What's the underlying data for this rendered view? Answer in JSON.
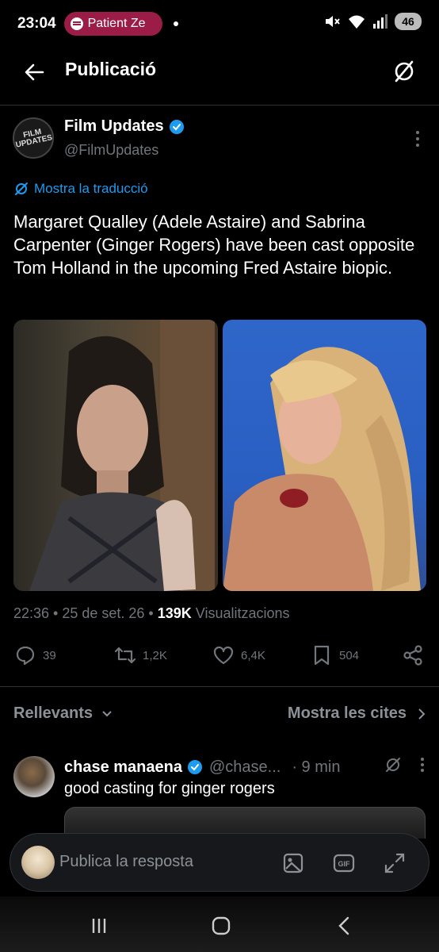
{
  "status_bar": {
    "time": "23:04",
    "spotify_label": "Patient Ze",
    "battery": "46"
  },
  "header": {
    "title": "Publicació"
  },
  "post": {
    "author_name": "Film Updates",
    "author_handle": "@FilmUpdates",
    "avatar_text": "FILM UPDATES",
    "translate_label": "Mostra la traducció",
    "text": "Margaret Qualley (Adele Astaire) and Sabrina Carpenter (Ginger Rogers) have been cast opposite Tom Holland in the upcoming Fred Astaire biopic.",
    "meta_time": "22:36 • 25 de set. 26 • ",
    "views_count": "139K",
    "views_label": " Visualitzacions",
    "replies": "39",
    "reposts": "1,2K",
    "likes": "6,4K",
    "bookmarks": "504"
  },
  "sort": {
    "left_label": "Rellevants",
    "right_label": "Mostra les cites"
  },
  "reply": {
    "name": "chase manaena",
    "handle": "@chase...",
    "time": "· 9 min",
    "text": "good casting for ginger rogers"
  },
  "compose": {
    "placeholder": "Publica la resposta"
  },
  "colors": {
    "accent": "#1d9bf0",
    "muted": "#71767b",
    "spotify_pill": "#9b1c47"
  }
}
